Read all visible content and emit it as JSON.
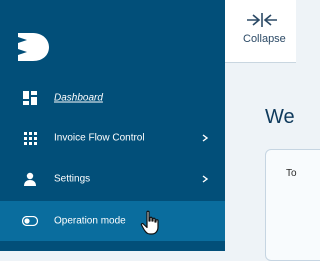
{
  "sidebar": {
    "items": [
      {
        "label": "Dashboard",
        "icon": "dashboard-icon"
      },
      {
        "label": "Invoice Flow Control",
        "icon": "grid-icon"
      },
      {
        "label": "Settings",
        "icon": "user-icon"
      },
      {
        "label": "Operation mode",
        "icon": "toggle-icon"
      }
    ]
  },
  "header": {
    "collapse_label": "Collapse"
  },
  "main": {
    "welcome_text": "We",
    "card_label": "To"
  },
  "colors": {
    "sidebar_bg": "#024f79",
    "active_item_bg": "#0a6d9e",
    "accent_text": "#0f3a5c"
  }
}
